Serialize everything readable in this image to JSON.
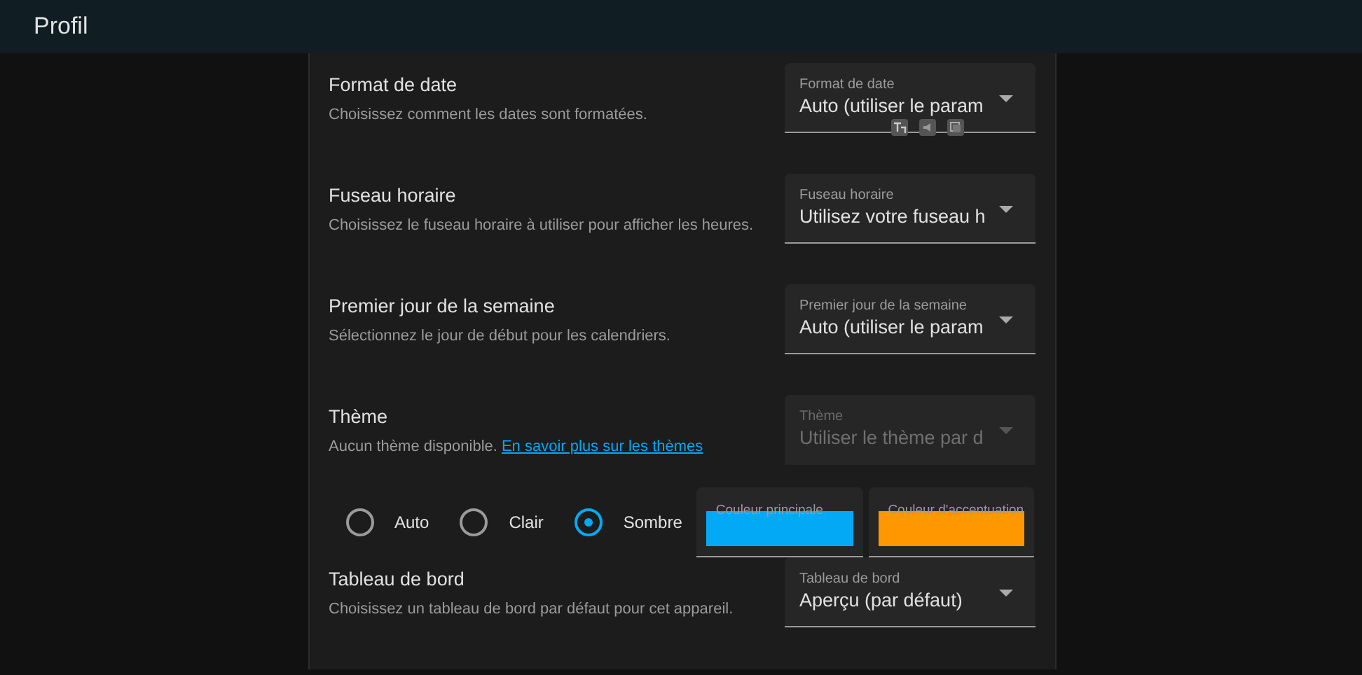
{
  "header": {
    "title": "Profil"
  },
  "rows": [
    {
      "kind": "select",
      "title": "Format de date",
      "description": "Choisissez comment les dates sont formatées.",
      "field": {
        "label": "Format de date",
        "value": "Auto (utiliser le param",
        "disabled": false,
        "tools": true
      }
    },
    {
      "kind": "select",
      "title": "Fuseau horaire",
      "description": "Choisissez le fuseau horaire à utiliser pour afficher les heures.",
      "field": {
        "label": "Fuseau horaire",
        "value": "Utilisez votre fuseau h",
        "disabled": false,
        "tools": false
      }
    },
    {
      "kind": "select",
      "title": "Premier jour de la semaine",
      "description": "Sélectionnez le jour de début pour les calendriers.",
      "field": {
        "label": "Premier jour de la semaine",
        "value": "Auto (utiliser le param",
        "disabled": false,
        "tools": false
      }
    },
    {
      "kind": "theme",
      "title": "Thème",
      "description": "Aucun thème disponible.",
      "link": "En savoir plus sur les thèmes",
      "field": {
        "label": "Thème",
        "value": "Utiliser le thème par d",
        "disabled": true,
        "tools": false
      },
      "modes": [
        {
          "label": "Auto",
          "selected": false
        },
        {
          "label": "Clair",
          "selected": false
        },
        {
          "label": "Sombre",
          "selected": true
        }
      ],
      "colors": [
        {
          "label": "Couleur principale",
          "color": "#03a9f4"
        },
        {
          "label": "Couleur d'accentuation",
          "color": "#ff9800"
        }
      ]
    },
    {
      "kind": "select",
      "title": "Tableau de bord",
      "description": "Choisissez un tableau de bord par défaut pour cet appareil.",
      "field": {
        "label": "Tableau de bord",
        "value": "Aperçu (par défaut)",
        "disabled": false,
        "tools": false
      }
    }
  ]
}
